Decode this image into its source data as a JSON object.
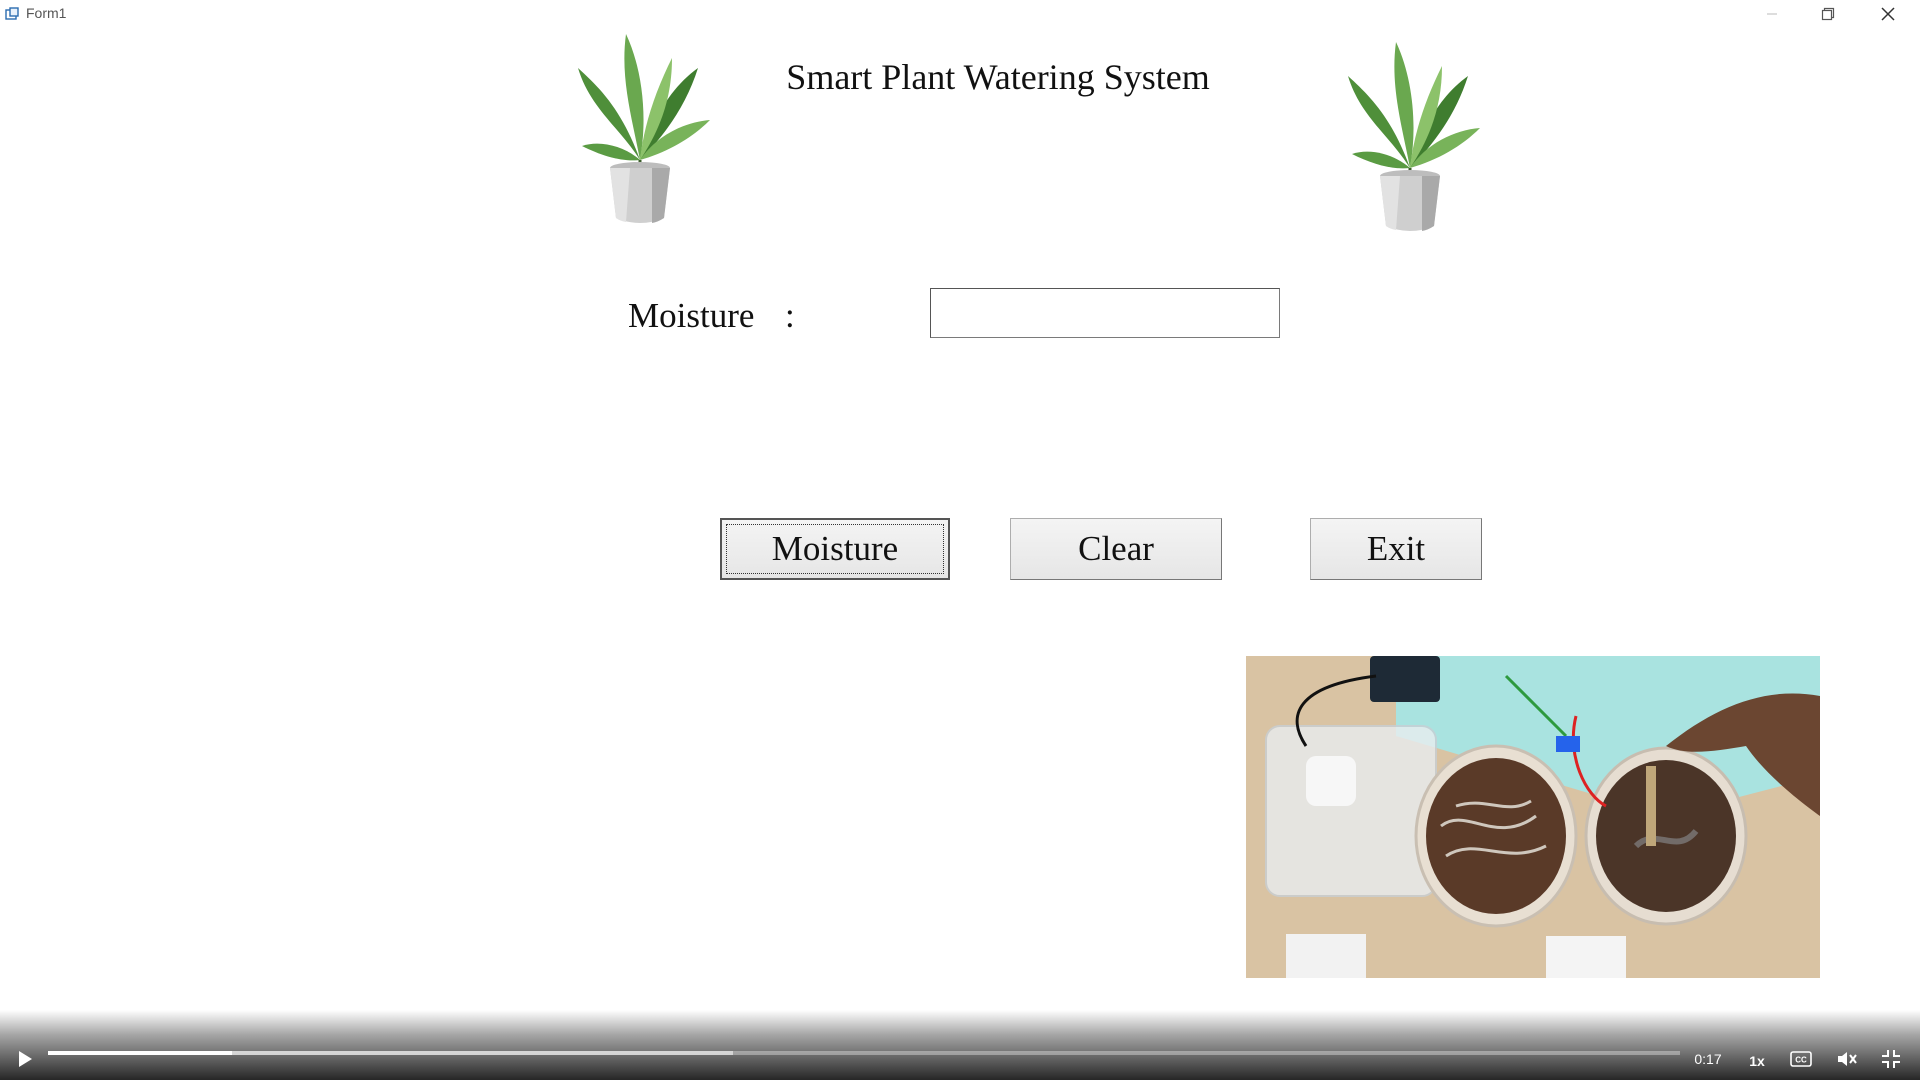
{
  "window": {
    "title": "Form1",
    "controls": {
      "minimize_icon": "minimize-icon",
      "restore_icon": "restore-icon",
      "close_icon": "close-icon"
    }
  },
  "header": {
    "title": "Smart Plant Watering System",
    "left_image": "potted-plant",
    "right_image": "potted-plant"
  },
  "form": {
    "moisture_label": "Moisture",
    "separator": ":",
    "moisture_value": "",
    "moisture_placeholder": ""
  },
  "buttons": {
    "moisture": "Moisture",
    "clear": "Clear",
    "exit": "Exit"
  },
  "video_overlay": {
    "subject": "soil moisture sensor test with two soil dishes"
  },
  "player": {
    "time": "0:17",
    "speed": "1x",
    "progress_fraction": 0.113,
    "buffered_fraction": 0.42,
    "icons": {
      "play": "play-icon",
      "captions": "closed-captions-icon",
      "mute": "muted-speaker-icon",
      "exit_fullscreen": "exit-fullscreen-icon"
    }
  },
  "colors": {
    "background": "#ffffff",
    "button_face": "#ececec",
    "control_bar": "#000000",
    "progress": "#ffffff"
  }
}
